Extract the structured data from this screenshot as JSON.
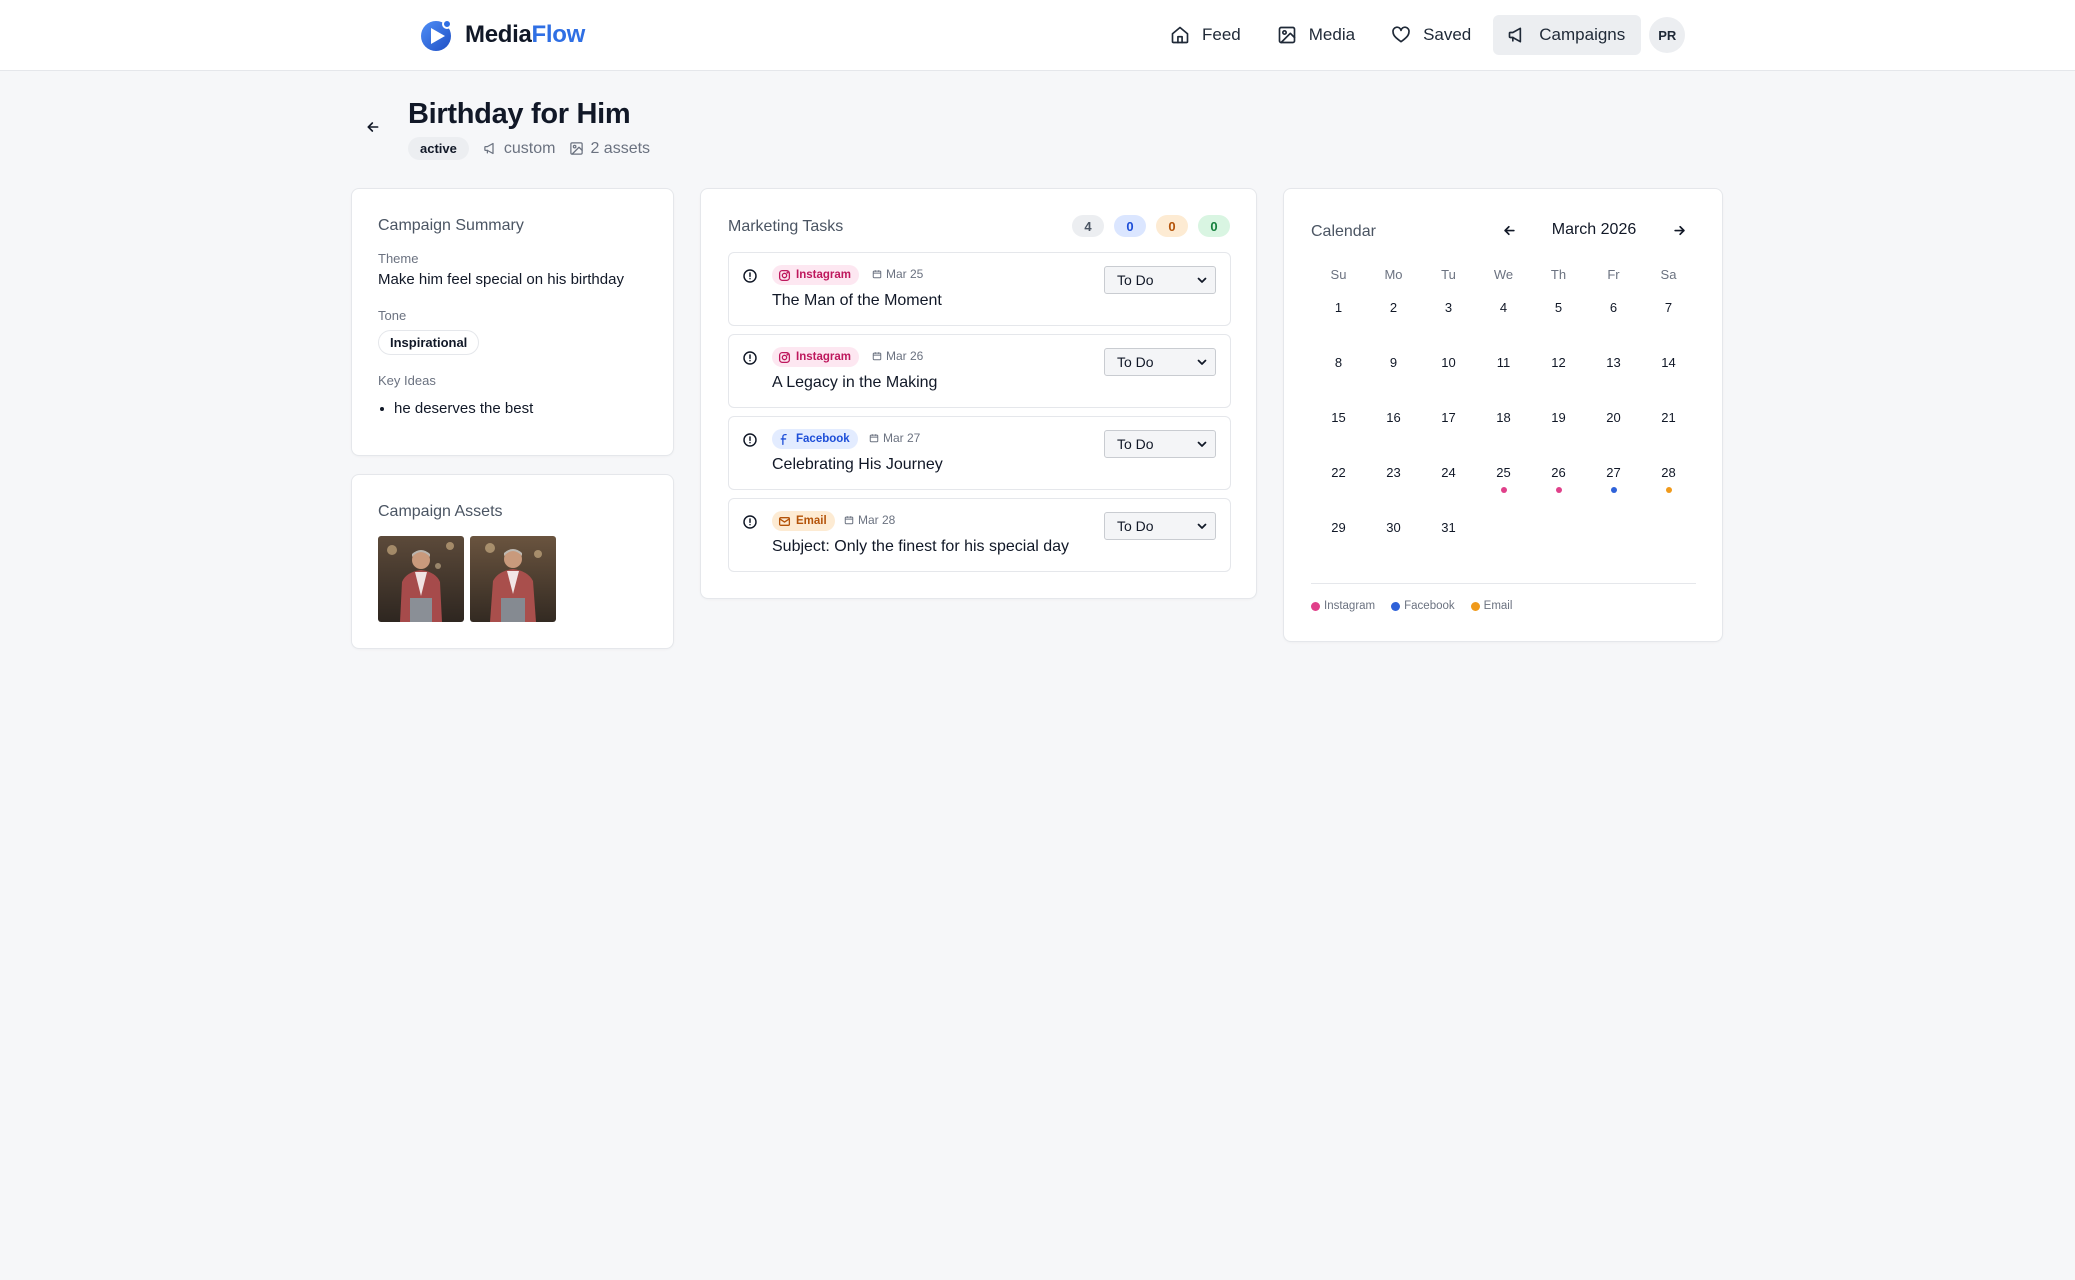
{
  "app": {
    "brand_part1": "Media",
    "brand_part2": "Flow",
    "brand_color": "#2f6fe4"
  },
  "nav": {
    "items": [
      {
        "label": "Feed",
        "icon": "home-icon",
        "active": false
      },
      {
        "label": "Media",
        "icon": "image-icon",
        "active": false
      },
      {
        "label": "Saved",
        "icon": "heart-icon",
        "active": false
      },
      {
        "label": "Campaigns",
        "icon": "megaphone-icon",
        "active": true
      }
    ],
    "avatar_initials": "PR"
  },
  "campaign": {
    "title": "Birthday for Him",
    "status": "active",
    "type": "custom",
    "assets_count": "2 assets"
  },
  "summary": {
    "title": "Campaign Summary",
    "theme_label": "Theme",
    "theme_value": "Make him feel special on his birthday",
    "tone_label": "Tone",
    "tone_value": "Inspirational",
    "key_ideas_label": "Key Ideas",
    "key_ideas": [
      "he deserves the best"
    ]
  },
  "assets": {
    "title": "Campaign Assets",
    "images": [
      {
        "icon": "man-in-red-jacket-photo"
      },
      {
        "icon": "man-in-red-jacket-photo"
      }
    ]
  },
  "tasks": {
    "title": "Marketing Tasks",
    "counts": [
      {
        "value": "4",
        "bg": "#eceef1",
        "fg": "#4b5563"
      },
      {
        "value": "0",
        "bg": "#dbe6ff",
        "fg": "#1d4ed8"
      },
      {
        "value": "0",
        "bg": "#fdebd3",
        "fg": "#b45309"
      },
      {
        "value": "0",
        "bg": "#d9f5e2",
        "fg": "#15803d"
      }
    ],
    "items": [
      {
        "channel": "Instagram",
        "channel_key": "instagram",
        "date": "Mar 25",
        "title": "The Man of the Moment",
        "status": "To Do"
      },
      {
        "channel": "Instagram",
        "channel_key": "instagram",
        "date": "Mar 26",
        "title": "A Legacy in the Making",
        "status": "To Do"
      },
      {
        "channel": "Facebook",
        "channel_key": "facebook",
        "date": "Mar 27",
        "title": "Celebrating His Journey",
        "status": "To Do"
      },
      {
        "channel": "Email",
        "channel_key": "email",
        "date": "Mar 28",
        "title": "Subject: Only the finest for his special day",
        "status": "To Do"
      }
    ]
  },
  "calendar": {
    "title": "Calendar",
    "month_label": "March 2026",
    "weekdays": [
      "Su",
      "Mo",
      "Tu",
      "We",
      "Th",
      "Fr",
      "Sa"
    ],
    "weeks": [
      [
        "1",
        "2",
        "3",
        "4",
        "5",
        "6",
        "7"
      ],
      [
        "8",
        "9",
        "10",
        "11",
        "12",
        "13",
        "14"
      ],
      [
        "15",
        "16",
        "17",
        "18",
        "19",
        "20",
        "21"
      ],
      [
        "22",
        "23",
        "24",
        "25",
        "26",
        "27",
        "28"
      ],
      [
        "29",
        "30",
        "31",
        "",
        "",
        "",
        ""
      ]
    ],
    "markers": {
      "25": "instagram",
      "26": "instagram",
      "27": "facebook",
      "28": "email"
    },
    "legend": [
      {
        "label": "Instagram",
        "color": "#e0408a"
      },
      {
        "label": "Facebook",
        "color": "#2f62d9"
      },
      {
        "label": "Email",
        "color": "#f09a1b"
      }
    ]
  }
}
